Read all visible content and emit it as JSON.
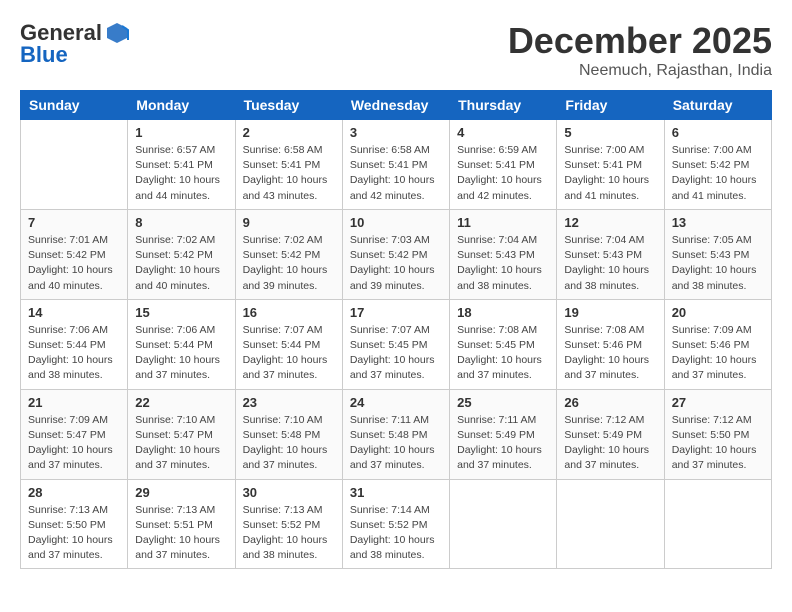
{
  "header": {
    "logo_general": "General",
    "logo_blue": "Blue",
    "month": "December 2025",
    "location": "Neemuch, Rajasthan, India"
  },
  "weekdays": [
    "Sunday",
    "Monday",
    "Tuesday",
    "Wednesday",
    "Thursday",
    "Friday",
    "Saturday"
  ],
  "weeks": [
    [
      {
        "day": "",
        "sunrise": "",
        "sunset": "",
        "daylight": ""
      },
      {
        "day": "1",
        "sunrise": "Sunrise: 6:57 AM",
        "sunset": "Sunset: 5:41 PM",
        "daylight": "Daylight: 10 hours and 44 minutes."
      },
      {
        "day": "2",
        "sunrise": "Sunrise: 6:58 AM",
        "sunset": "Sunset: 5:41 PM",
        "daylight": "Daylight: 10 hours and 43 minutes."
      },
      {
        "day": "3",
        "sunrise": "Sunrise: 6:58 AM",
        "sunset": "Sunset: 5:41 PM",
        "daylight": "Daylight: 10 hours and 42 minutes."
      },
      {
        "day": "4",
        "sunrise": "Sunrise: 6:59 AM",
        "sunset": "Sunset: 5:41 PM",
        "daylight": "Daylight: 10 hours and 42 minutes."
      },
      {
        "day": "5",
        "sunrise": "Sunrise: 7:00 AM",
        "sunset": "Sunset: 5:41 PM",
        "daylight": "Daylight: 10 hours and 41 minutes."
      },
      {
        "day": "6",
        "sunrise": "Sunrise: 7:00 AM",
        "sunset": "Sunset: 5:42 PM",
        "daylight": "Daylight: 10 hours and 41 minutes."
      }
    ],
    [
      {
        "day": "7",
        "sunrise": "Sunrise: 7:01 AM",
        "sunset": "Sunset: 5:42 PM",
        "daylight": "Daylight: 10 hours and 40 minutes."
      },
      {
        "day": "8",
        "sunrise": "Sunrise: 7:02 AM",
        "sunset": "Sunset: 5:42 PM",
        "daylight": "Daylight: 10 hours and 40 minutes."
      },
      {
        "day": "9",
        "sunrise": "Sunrise: 7:02 AM",
        "sunset": "Sunset: 5:42 PM",
        "daylight": "Daylight: 10 hours and 39 minutes."
      },
      {
        "day": "10",
        "sunrise": "Sunrise: 7:03 AM",
        "sunset": "Sunset: 5:42 PM",
        "daylight": "Daylight: 10 hours and 39 minutes."
      },
      {
        "day": "11",
        "sunrise": "Sunrise: 7:04 AM",
        "sunset": "Sunset: 5:43 PM",
        "daylight": "Daylight: 10 hours and 38 minutes."
      },
      {
        "day": "12",
        "sunrise": "Sunrise: 7:04 AM",
        "sunset": "Sunset: 5:43 PM",
        "daylight": "Daylight: 10 hours and 38 minutes."
      },
      {
        "day": "13",
        "sunrise": "Sunrise: 7:05 AM",
        "sunset": "Sunset: 5:43 PM",
        "daylight": "Daylight: 10 hours and 38 minutes."
      }
    ],
    [
      {
        "day": "14",
        "sunrise": "Sunrise: 7:06 AM",
        "sunset": "Sunset: 5:44 PM",
        "daylight": "Daylight: 10 hours and 38 minutes."
      },
      {
        "day": "15",
        "sunrise": "Sunrise: 7:06 AM",
        "sunset": "Sunset: 5:44 PM",
        "daylight": "Daylight: 10 hours and 37 minutes."
      },
      {
        "day": "16",
        "sunrise": "Sunrise: 7:07 AM",
        "sunset": "Sunset: 5:44 PM",
        "daylight": "Daylight: 10 hours and 37 minutes."
      },
      {
        "day": "17",
        "sunrise": "Sunrise: 7:07 AM",
        "sunset": "Sunset: 5:45 PM",
        "daylight": "Daylight: 10 hours and 37 minutes."
      },
      {
        "day": "18",
        "sunrise": "Sunrise: 7:08 AM",
        "sunset": "Sunset: 5:45 PM",
        "daylight": "Daylight: 10 hours and 37 minutes."
      },
      {
        "day": "19",
        "sunrise": "Sunrise: 7:08 AM",
        "sunset": "Sunset: 5:46 PM",
        "daylight": "Daylight: 10 hours and 37 minutes."
      },
      {
        "day": "20",
        "sunrise": "Sunrise: 7:09 AM",
        "sunset": "Sunset: 5:46 PM",
        "daylight": "Daylight: 10 hours and 37 minutes."
      }
    ],
    [
      {
        "day": "21",
        "sunrise": "Sunrise: 7:09 AM",
        "sunset": "Sunset: 5:47 PM",
        "daylight": "Daylight: 10 hours and 37 minutes."
      },
      {
        "day": "22",
        "sunrise": "Sunrise: 7:10 AM",
        "sunset": "Sunset: 5:47 PM",
        "daylight": "Daylight: 10 hours and 37 minutes."
      },
      {
        "day": "23",
        "sunrise": "Sunrise: 7:10 AM",
        "sunset": "Sunset: 5:48 PM",
        "daylight": "Daylight: 10 hours and 37 minutes."
      },
      {
        "day": "24",
        "sunrise": "Sunrise: 7:11 AM",
        "sunset": "Sunset: 5:48 PM",
        "daylight": "Daylight: 10 hours and 37 minutes."
      },
      {
        "day": "25",
        "sunrise": "Sunrise: 7:11 AM",
        "sunset": "Sunset: 5:49 PM",
        "daylight": "Daylight: 10 hours and 37 minutes."
      },
      {
        "day": "26",
        "sunrise": "Sunrise: 7:12 AM",
        "sunset": "Sunset: 5:49 PM",
        "daylight": "Daylight: 10 hours and 37 minutes."
      },
      {
        "day": "27",
        "sunrise": "Sunrise: 7:12 AM",
        "sunset": "Sunset: 5:50 PM",
        "daylight": "Daylight: 10 hours and 37 minutes."
      }
    ],
    [
      {
        "day": "28",
        "sunrise": "Sunrise: 7:13 AM",
        "sunset": "Sunset: 5:50 PM",
        "daylight": "Daylight: 10 hours and 37 minutes."
      },
      {
        "day": "29",
        "sunrise": "Sunrise: 7:13 AM",
        "sunset": "Sunset: 5:51 PM",
        "daylight": "Daylight: 10 hours and 37 minutes."
      },
      {
        "day": "30",
        "sunrise": "Sunrise: 7:13 AM",
        "sunset": "Sunset: 5:52 PM",
        "daylight": "Daylight: 10 hours and 38 minutes."
      },
      {
        "day": "31",
        "sunrise": "Sunrise: 7:14 AM",
        "sunset": "Sunset: 5:52 PM",
        "daylight": "Daylight: 10 hours and 38 minutes."
      },
      {
        "day": "",
        "sunrise": "",
        "sunset": "",
        "daylight": ""
      },
      {
        "day": "",
        "sunrise": "",
        "sunset": "",
        "daylight": ""
      },
      {
        "day": "",
        "sunrise": "",
        "sunset": "",
        "daylight": ""
      }
    ]
  ]
}
